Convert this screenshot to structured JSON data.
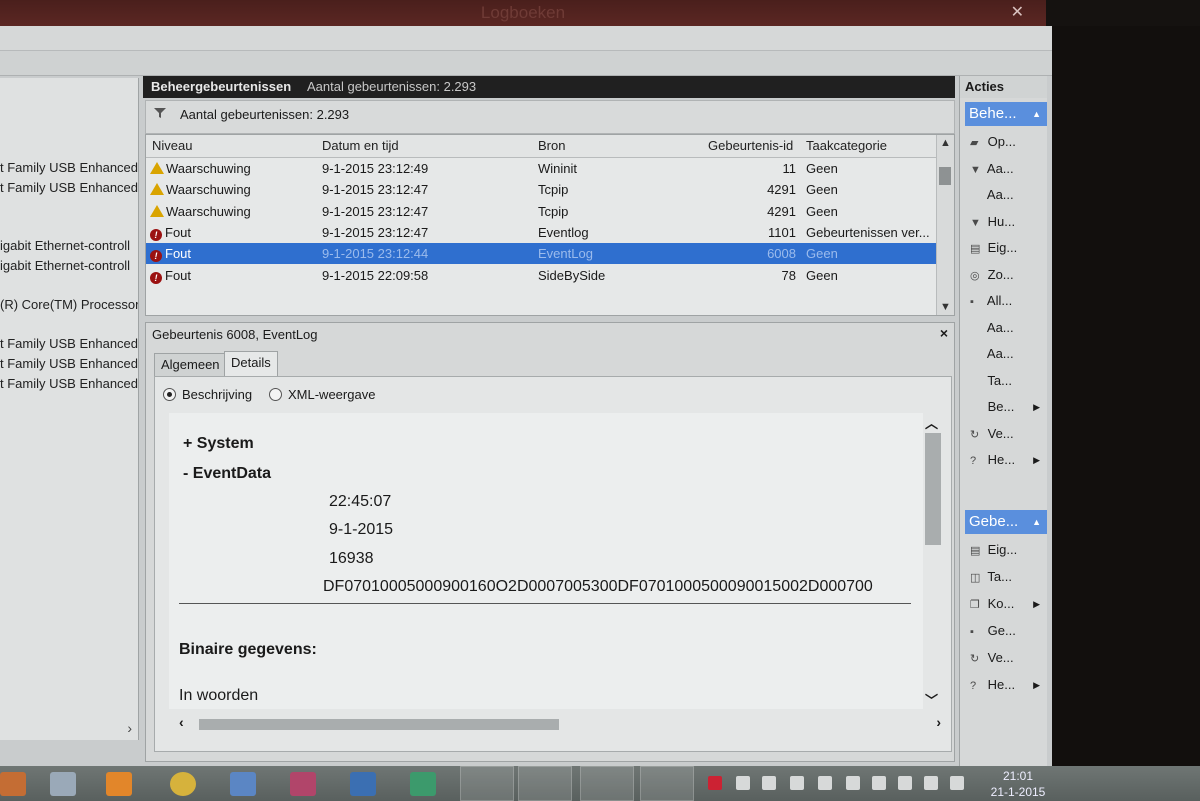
{
  "window": {
    "title": "Logboeken",
    "close_glyph": "✕"
  },
  "tree": {
    "lines": [
      "t Family USB Enhanced",
      "t Family USB Enhanced",
      "igabit Ethernet-controll",
      "igabit Ethernet-controll",
      "(R) Core(TM) Processor",
      "t Family USB Enhanced",
      "t Family USB Enhanced",
      "t Family USB Enhanced"
    ],
    "scroll_glyph": "›"
  },
  "center": {
    "header_title": "Beheergebeurtenissen",
    "header_count": "Aantal gebeurtenissen: 2.293",
    "filter_text": "Aantal gebeurtenissen: 2.293",
    "columns": [
      "Niveau",
      "Datum en tijd",
      "Bron",
      "Gebeurtenis-id",
      "Taakcategorie"
    ],
    "rows": [
      {
        "level": "Waarschuwing",
        "icon": "warning-icon",
        "date": "9-1-2015 23:12:49",
        "source": "Wininit",
        "id": "11",
        "category": "Geen"
      },
      {
        "level": "Waarschuwing",
        "icon": "warning-icon",
        "date": "9-1-2015 23:12:47",
        "source": "Tcpip",
        "id": "4291",
        "category": "Geen"
      },
      {
        "level": "Waarschuwing",
        "icon": "warning-icon",
        "date": "9-1-2015 23:12:47",
        "source": "Tcpip",
        "id": "4291",
        "category": "Geen"
      },
      {
        "level": "Fout",
        "icon": "error-icon",
        "date": "9-1-2015 23:12:47",
        "source": "Eventlog",
        "id": "1101",
        "category": "Gebeurtenissen ver..."
      },
      {
        "level": "Fout",
        "icon": "error-icon",
        "date": "9-1-2015 23:12:44",
        "source": "EventLog",
        "id": "6008",
        "category": "Geen",
        "selected": true
      },
      {
        "level": "Fout",
        "icon": "error-icon",
        "date": "9-1-2015 22:09:58",
        "source": "SideBySide",
        "id": "78",
        "category": "Geen"
      }
    ]
  },
  "detail": {
    "title": "Gebeurtenis 6008, EventLog",
    "close": "×",
    "tabs": [
      "Algemeen",
      "Details"
    ],
    "radios": [
      "Beschrijving",
      "XML-weergave"
    ],
    "system_label": "+ System",
    "eventdata_label": "-  EventData",
    "values": [
      "22:45:07",
      "9-1-2015",
      "16938",
      "DF07010005000900160O2D0007005300DF0701000500090015002D000700"
    ],
    "binary_label": "Binaire gegevens:",
    "words_label": "In woorden"
  },
  "actions": {
    "header": "Acties",
    "section1": "Behe...",
    "items1": [
      {
        "icon": "open-icon",
        "label": "Op..."
      },
      {
        "icon": "filter-icon",
        "label": "Aa..."
      },
      {
        "icon": "blank-icon",
        "label": "Aa..."
      },
      {
        "icon": "funnel-icon",
        "label": "Hu..."
      },
      {
        "icon": "properties-icon",
        "label": "Eig..."
      },
      {
        "icon": "find-icon",
        "label": "Zo..."
      },
      {
        "icon": "save-icon",
        "label": "All..."
      },
      {
        "icon": "blank-icon",
        "label": "Aa..."
      },
      {
        "icon": "blank-icon",
        "label": "Aa..."
      },
      {
        "icon": "blank-icon",
        "label": "Ta..."
      },
      {
        "icon": "blank-icon",
        "label": "Be...",
        "submenu": true
      },
      {
        "icon": "refresh-icon",
        "label": "Ve..."
      },
      {
        "icon": "help-icon",
        "label": "He...",
        "submenu": true
      }
    ],
    "section2": "Gebe...",
    "items2": [
      {
        "icon": "properties-icon",
        "label": "Eig..."
      },
      {
        "icon": "task-icon",
        "label": "Ta..."
      },
      {
        "icon": "copy-icon",
        "label": "Ko...",
        "submenu": true
      },
      {
        "icon": "save-icon",
        "label": "Ge..."
      },
      {
        "icon": "refresh-icon",
        "label": "Ve..."
      },
      {
        "icon": "help-icon",
        "label": "He...",
        "submenu": true
      }
    ]
  },
  "taskbar": {
    "time": "21:01",
    "date": "21-1-2015"
  },
  "colors": {
    "selection": "#2f6fcf",
    "section_header": "#5a8fdd",
    "warning": "#d9a400",
    "error": "#9b1111"
  }
}
